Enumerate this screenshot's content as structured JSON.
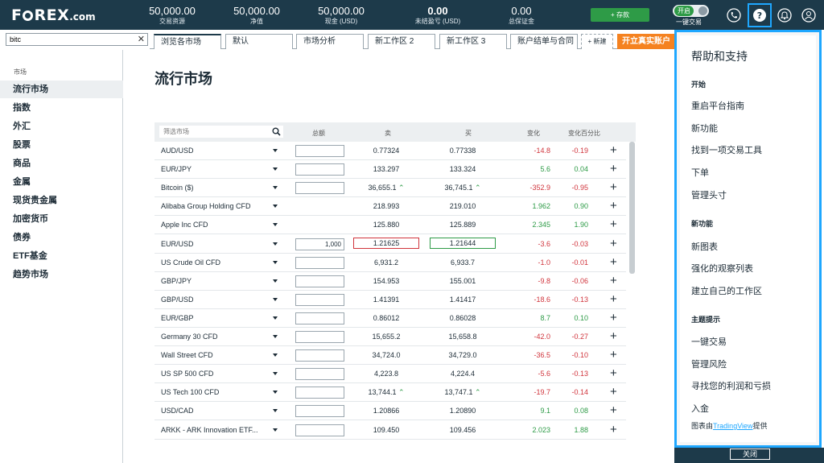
{
  "brand": {
    "logo_main": "F",
    "logo_rest": "REX",
    "logo_suffix": ".com"
  },
  "stats": [
    {
      "value": "50,000.00",
      "label": "交易资源"
    },
    {
      "value": "50,000.00",
      "label": "净值"
    },
    {
      "value": "50,000.00",
      "label": "现金 (USD)"
    },
    {
      "value": "0.00",
      "label": "未结盈亏 (USD)"
    },
    {
      "value": "0.00",
      "label": "总保证金"
    }
  ],
  "header": {
    "deposit_label": "+ 存款",
    "toggle_on_label": "开启",
    "one_click_label": "一键交易",
    "icons": [
      "phone-icon",
      "help-icon",
      "bell-icon",
      "user-icon"
    ]
  },
  "search": {
    "value": "bitc"
  },
  "tabs": [
    {
      "label": "浏览各市场"
    },
    {
      "label": "默认"
    },
    {
      "label": "市场分析"
    },
    {
      "label": "新工作区 2"
    },
    {
      "label": "新工作区 3"
    },
    {
      "label": "账户结单与合同"
    },
    {
      "label": "+ 新建"
    }
  ],
  "open_account_label": "开立真实账户",
  "sidebar": {
    "heading": "市场",
    "items": [
      {
        "label": "流行市场"
      },
      {
        "label": "指数"
      },
      {
        "label": "外汇"
      },
      {
        "label": "股票"
      },
      {
        "label": "商品"
      },
      {
        "label": "金属"
      },
      {
        "label": "现货贵金属"
      },
      {
        "label": "加密货币"
      },
      {
        "label": "债券"
      },
      {
        "label": "ETF基金"
      },
      {
        "label": "趋势市场"
      }
    ]
  },
  "main": {
    "title": "流行市场",
    "filter_placeholder": "筛选市场",
    "columns": {
      "amount": "总额",
      "sell": "卖",
      "buy": "买",
      "change": "变化",
      "change_pct": "变化百分比"
    },
    "rows": [
      {
        "name": "AUD/USD",
        "qty": "",
        "has_qty": true,
        "sell": "0.77324",
        "buy": "0.77338",
        "sell_up": false,
        "buy_up": false,
        "change": "-14.8",
        "pct": "-0.19",
        "dir": "neg",
        "boxed": false
      },
      {
        "name": "EUR/JPY",
        "qty": "",
        "has_qty": true,
        "sell": "133.297",
        "buy": "133.324",
        "sell_up": false,
        "buy_up": false,
        "change": "5.6",
        "pct": "0.04",
        "dir": "pos",
        "boxed": false
      },
      {
        "name": "Bitcoin ($)",
        "qty": "",
        "has_qty": true,
        "sell": "36,655.1",
        "buy": "36,745.1",
        "sell_up": true,
        "buy_up": true,
        "change": "-352.9",
        "pct": "-0.95",
        "dir": "neg",
        "boxed": false
      },
      {
        "name": "Alibaba Group Holding CFD",
        "qty": "",
        "has_qty": false,
        "sell": "218.993",
        "buy": "219.010",
        "sell_up": false,
        "buy_up": false,
        "change": "1.962",
        "pct": "0.90",
        "dir": "pos",
        "boxed": false
      },
      {
        "name": "Apple Inc CFD",
        "qty": "",
        "has_qty": false,
        "sell": "125.880",
        "buy": "125.889",
        "sell_up": false,
        "buy_up": false,
        "change": "2.345",
        "pct": "1.90",
        "dir": "pos",
        "boxed": false
      },
      {
        "name": "EUR/USD",
        "qty": "1,000",
        "has_qty": true,
        "sell": "1.21625",
        "buy": "1.21644",
        "sell_up": false,
        "buy_up": false,
        "change": "-3.6",
        "pct": "-0.03",
        "dir": "neg",
        "boxed": true
      },
      {
        "name": "US Crude Oil CFD",
        "qty": "",
        "has_qty": true,
        "sell": "6,931.2",
        "buy": "6,933.7",
        "sell_up": false,
        "buy_up": false,
        "change": "-1.0",
        "pct": "-0.01",
        "dir": "neg",
        "boxed": false
      },
      {
        "name": "GBP/JPY",
        "qty": "",
        "has_qty": true,
        "sell": "154.953",
        "buy": "155.001",
        "sell_up": false,
        "buy_up": false,
        "change": "-9.8",
        "pct": "-0.06",
        "dir": "neg",
        "boxed": false
      },
      {
        "name": "GBP/USD",
        "qty": "",
        "has_qty": true,
        "sell": "1.41391",
        "buy": "1.41417",
        "sell_up": false,
        "buy_up": false,
        "change": "-18.6",
        "pct": "-0.13",
        "dir": "neg",
        "boxed": false
      },
      {
        "name": "EUR/GBP",
        "qty": "",
        "has_qty": true,
        "sell": "0.86012",
        "buy": "0.86028",
        "sell_up": false,
        "buy_up": false,
        "change": "8.7",
        "pct": "0.10",
        "dir": "pos",
        "boxed": false
      },
      {
        "name": "Germany 30 CFD",
        "qty": "",
        "has_qty": true,
        "sell": "15,655.2",
        "buy": "15,658.8",
        "sell_up": false,
        "buy_up": false,
        "change": "-42.0",
        "pct": "-0.27",
        "dir": "neg",
        "boxed": false
      },
      {
        "name": "Wall Street CFD",
        "qty": "",
        "has_qty": true,
        "sell": "34,724.0",
        "buy": "34,729.0",
        "sell_up": false,
        "buy_up": false,
        "change": "-36.5",
        "pct": "-0.10",
        "dir": "neg",
        "boxed": false
      },
      {
        "name": "US SP 500 CFD",
        "qty": "",
        "has_qty": true,
        "sell": "4,223.8",
        "buy": "4,224.4",
        "sell_up": false,
        "buy_up": false,
        "change": "-5.6",
        "pct": "-0.13",
        "dir": "neg",
        "boxed": false
      },
      {
        "name": "US Tech 100 CFD",
        "qty": "",
        "has_qty": true,
        "sell": "13,744.1",
        "buy": "13,747.1",
        "sell_up": true,
        "buy_up": true,
        "change": "-19.7",
        "pct": "-0.14",
        "dir": "neg",
        "boxed": false
      },
      {
        "name": "USD/CAD",
        "qty": "",
        "has_qty": true,
        "sell": "1.20866",
        "buy": "1.20890",
        "sell_up": false,
        "buy_up": false,
        "change": "9.1",
        "pct": "0.08",
        "dir": "pos",
        "boxed": false
      },
      {
        "name": "ARKK - ARK Innovation ETF...",
        "qty": "",
        "has_qty": true,
        "sell": "109.450",
        "buy": "109.456",
        "sell_up": false,
        "buy_up": false,
        "change": "2.023",
        "pct": "1.88",
        "dir": "pos",
        "boxed": false
      }
    ]
  },
  "help_panel": {
    "title": "帮助和支持",
    "sections": [
      {
        "heading": "开始",
        "items": [
          "重启平台指南",
          "新功能",
          "找到一项交易工具",
          "下单",
          "管理头寸"
        ]
      },
      {
        "heading": "新功能",
        "items": [
          "新图表",
          "强化的观察列表",
          "建立自己的工作区"
        ]
      },
      {
        "heading": "主题提示",
        "items": [
          "一键交易",
          "管理风险",
          "寻找您的利润和亏损",
          "入金"
        ]
      }
    ],
    "credit_prefix": "图表由",
    "credit_link": "TradingView",
    "credit_suffix": "提供",
    "close_label": "关闭"
  },
  "colors": {
    "header_bg": "#1d3a4a",
    "accent_blue": "#1ea7ff",
    "positive": "#2e9b47",
    "negative": "#d0343c",
    "orange": "#f58220"
  }
}
